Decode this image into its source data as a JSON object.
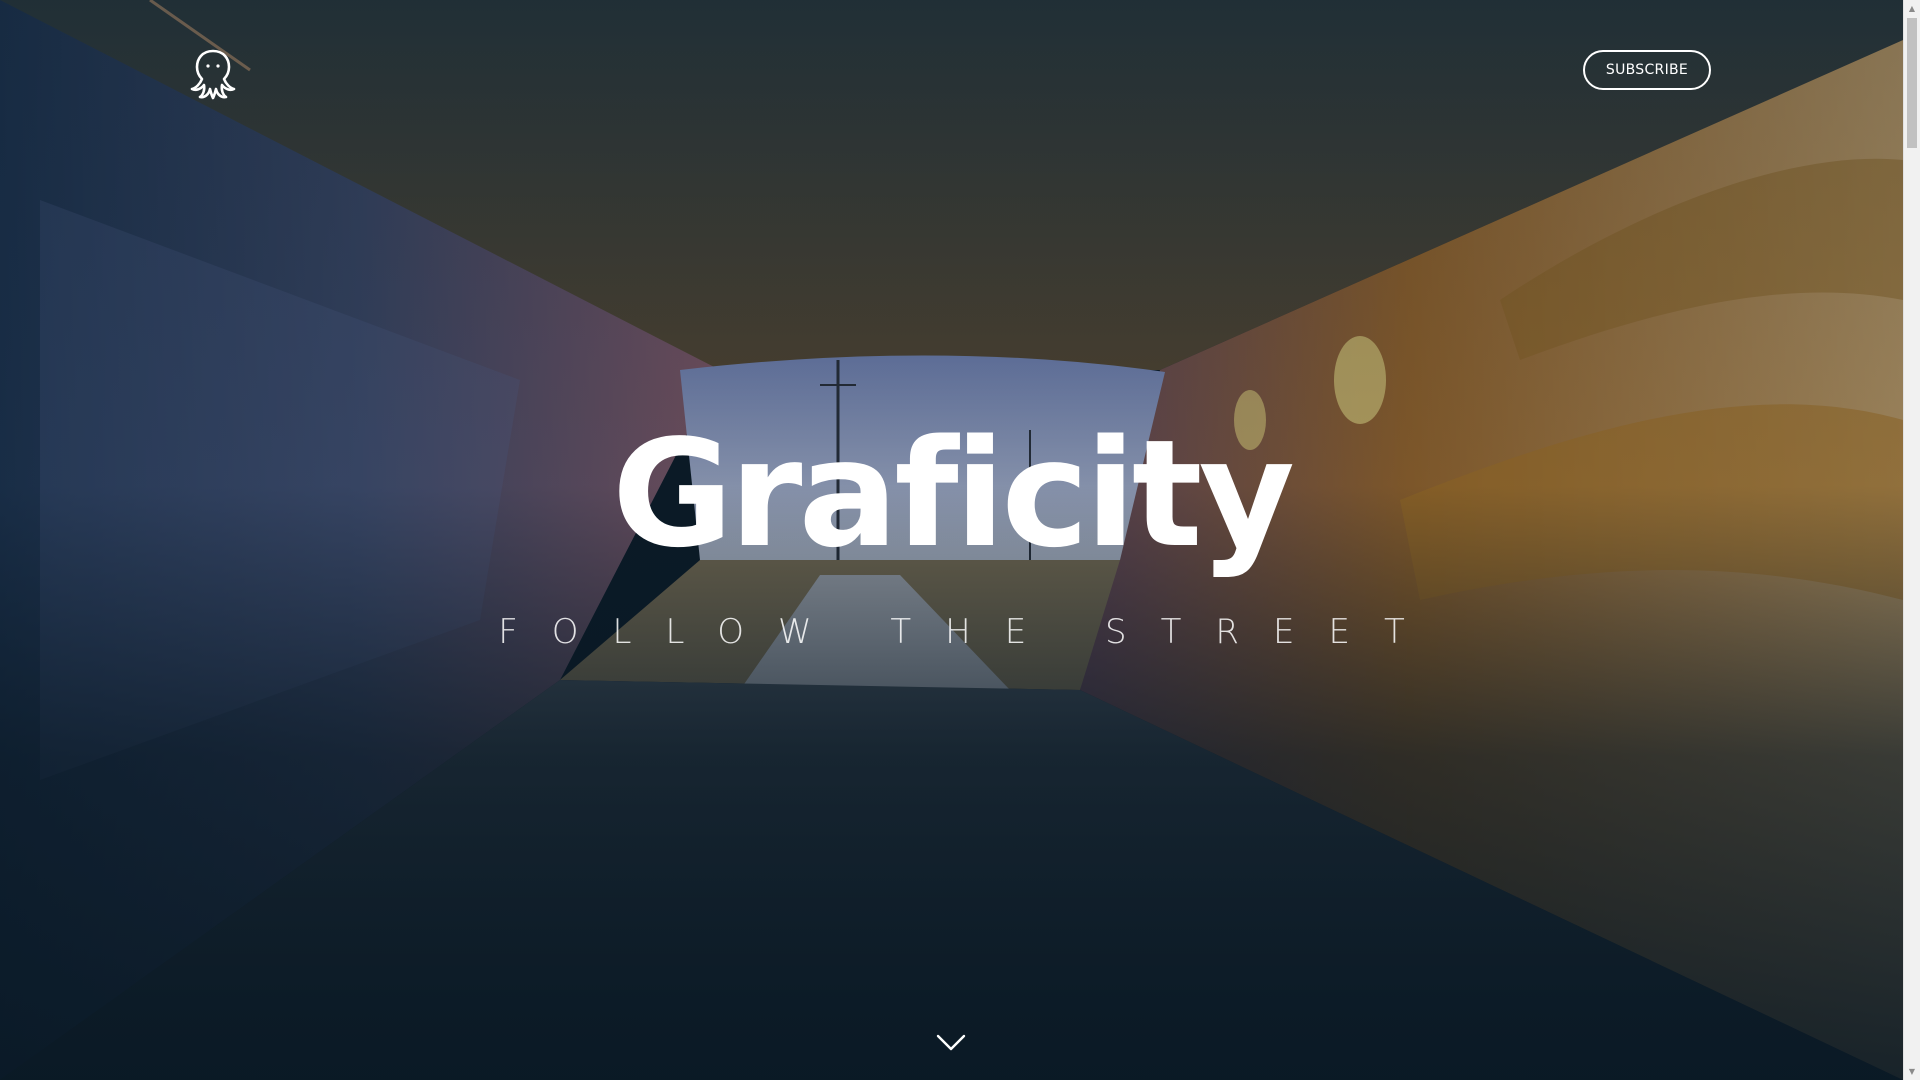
{
  "header": {
    "logo_icon": "octopus-icon",
    "subscribe_label": "SUBSCRIBE"
  },
  "hero": {
    "title": "Graficity",
    "tagline": "FOLLOW THE STREET",
    "scroll_icon": "chevron-down-icon"
  },
  "scrollbar": {
    "up_icon": "▲",
    "down_icon": "▼"
  },
  "colors": {
    "overlay": "#0b1b28",
    "text": "#ffffff",
    "sky": "#8fa0c8",
    "mural_warm": "#c98a2e"
  }
}
